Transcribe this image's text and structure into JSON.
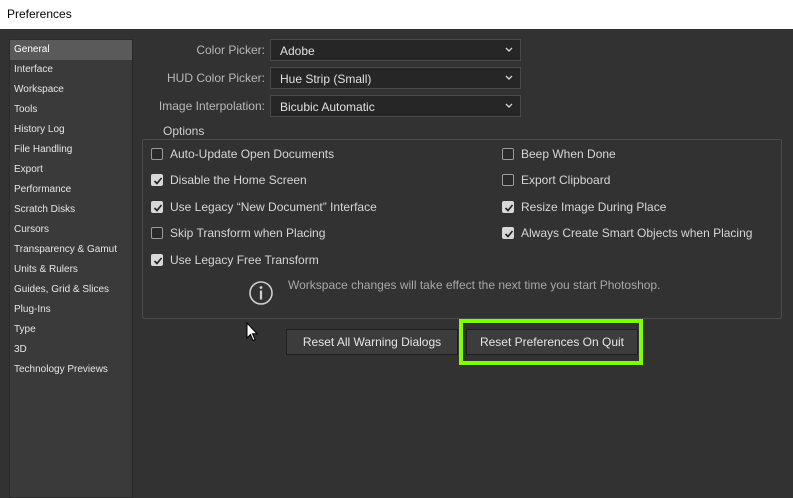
{
  "window": {
    "title": "Preferences"
  },
  "sidebar": {
    "items": [
      {
        "label": "General",
        "selected": true
      },
      {
        "label": "Interface"
      },
      {
        "label": "Workspace"
      },
      {
        "label": "Tools"
      },
      {
        "label": "History Log"
      },
      {
        "label": "File Handling"
      },
      {
        "label": "Export"
      },
      {
        "label": "Performance"
      },
      {
        "label": "Scratch Disks"
      },
      {
        "label": "Cursors"
      },
      {
        "label": "Transparency & Gamut"
      },
      {
        "label": "Units & Rulers"
      },
      {
        "label": "Guides, Grid & Slices"
      },
      {
        "label": "Plug-Ins"
      },
      {
        "label": "Type"
      },
      {
        "label": "3D"
      },
      {
        "label": "Technology Previews"
      }
    ]
  },
  "fields": {
    "color_picker": {
      "label": "Color Picker:",
      "value": "Adobe"
    },
    "hud_color_picker": {
      "label": "HUD Color Picker:",
      "value": "Hue Strip (Small)"
    },
    "image_interpolation": {
      "label": "Image Interpolation:",
      "value": "Bicubic Automatic"
    }
  },
  "options": {
    "title": "Options",
    "left": [
      {
        "label": "Auto-Update Open Documents",
        "checked": false
      },
      {
        "label": "Disable the Home Screen",
        "checked": true
      },
      {
        "label": "Use Legacy “New Document” Interface",
        "checked": true
      },
      {
        "label": "Skip Transform when Placing",
        "checked": false
      },
      {
        "label": "Use Legacy Free Transform",
        "checked": true
      }
    ],
    "right": [
      {
        "label": "Beep When Done",
        "checked": false
      },
      {
        "label": "Export Clipboard",
        "checked": false
      },
      {
        "label": "Resize Image During Place",
        "checked": true
      },
      {
        "label": "Always Create Smart Objects when Placing",
        "checked": true
      }
    ],
    "info_text": "Workspace changes will take effect the next time you start Photoshop."
  },
  "buttons": {
    "reset_warnings": "Reset All Warning Dialogs",
    "reset_prefs": "Reset Preferences On Quit"
  },
  "colors": {
    "highlight": "#7fff00",
    "background": "#323232"
  },
  "icons": {
    "info": "info-circle-icon",
    "chevron": "chevron-down-icon",
    "check": "check-icon",
    "cursor": "mouse-pointer-icon"
  }
}
